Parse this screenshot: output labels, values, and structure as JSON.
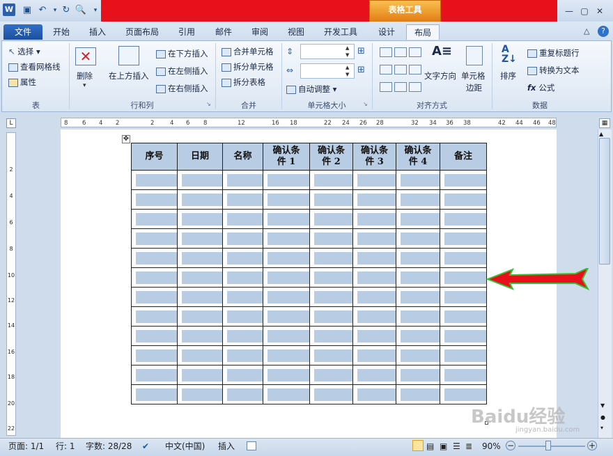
{
  "titlebar": {
    "context_tab": "表格工具"
  },
  "tabs": [
    "文件",
    "开始",
    "插入",
    "页面布局",
    "引用",
    "邮件",
    "审阅",
    "视图",
    "开发工具",
    "设计",
    "布局"
  ],
  "ribbon": {
    "table_group": {
      "select": "选择",
      "gridlines": "查看网格线",
      "properties": "属性",
      "label": "表"
    },
    "rows_cols": {
      "delete": "删除",
      "insert_above": "在上方插入",
      "insert_below": "在下方插入",
      "insert_left": "在左侧插入",
      "insert_right": "在右侧插入",
      "label": "行和列"
    },
    "merge": {
      "merge_cells": "合并单元格",
      "split_cells": "拆分单元格",
      "split_table": "拆分表格",
      "label": "合并"
    },
    "cell_size": {
      "autofit": "自动调整",
      "label": "单元格大小"
    },
    "alignment": {
      "text_direction": "文字方向",
      "cell_margins_1": "单元格",
      "cell_margins_2": "边距",
      "label": "对齐方式"
    },
    "data": {
      "sort": "排序",
      "repeat_header": "重复标题行",
      "convert_text": "转换为文本",
      "formula": "公式",
      "label": "数据"
    }
  },
  "ruler": {
    "ticks": [
      "8",
      "6",
      "4",
      "2",
      "2",
      "4",
      "6",
      "8",
      "12",
      "16",
      "18",
      "22",
      "24",
      "26",
      "28",
      "32",
      "34",
      "36",
      "38",
      "42",
      "44",
      "46",
      "48"
    ],
    "vticks": [
      "2",
      "4",
      "6",
      "8",
      "10",
      "12",
      "14",
      "16",
      "18",
      "20",
      "22"
    ]
  },
  "table": {
    "headers": [
      {
        "l1": "序号",
        "l2": ""
      },
      {
        "l1": "日期",
        "l2": ""
      },
      {
        "l1": "名称",
        "l2": ""
      },
      {
        "l1": "确认条",
        "l2": "件 1"
      },
      {
        "l1": "确认条",
        "l2": "件 2"
      },
      {
        "l1": "确认条",
        "l2": "件 3"
      },
      {
        "l1": "确认条",
        "l2": "件 4"
      },
      {
        "l1": "备注",
        "l2": ""
      }
    ],
    "row_count": 12
  },
  "status": {
    "page": "页面: 1/1",
    "line": "行: 1",
    "words": "字数: 28/28",
    "language": "中文(中国)",
    "insert": "插入",
    "zoom": "90%"
  },
  "watermark": {
    "main": "Baidu经验",
    "sub": "jingyan.baidu.com"
  },
  "colors": {
    "accent_red": "#e8111b",
    "table_band": "#b8cce4",
    "arrow": "#e8111b"
  }
}
